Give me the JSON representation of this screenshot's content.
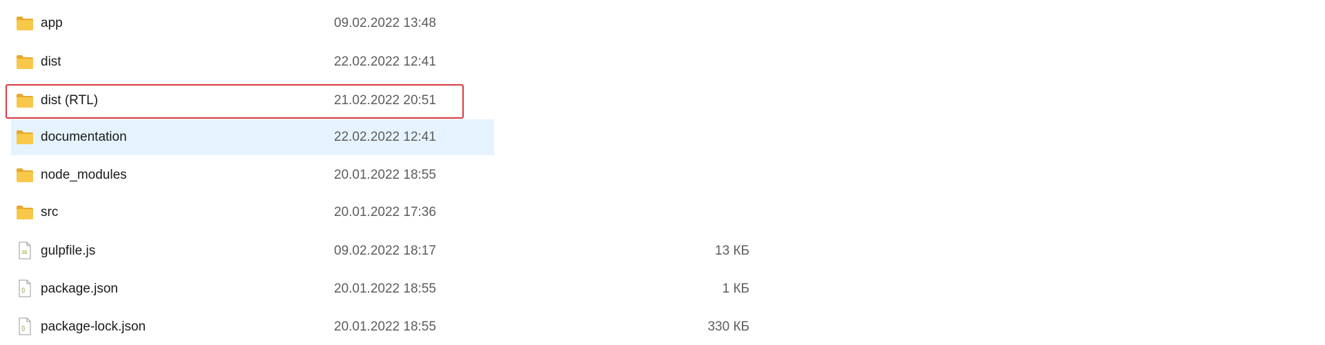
{
  "files": [
    {
      "name": "app",
      "modified": "09.02.2022 13:48",
      "size": "",
      "type": "folder-icon"
    },
    {
      "name": "dist",
      "modified": "22.02.2022 12:41",
      "size": "",
      "type": "folder-icon"
    },
    {
      "name": "dist (RTL)",
      "modified": "21.02.2022 20:51",
      "size": "",
      "type": "folder-icon"
    },
    {
      "name": "documentation",
      "modified": "22.02.2022 12:41",
      "size": "",
      "type": "folder-icon"
    },
    {
      "name": "node_modules",
      "modified": "20.01.2022 18:55",
      "size": "",
      "type": "folder-icon"
    },
    {
      "name": "src",
      "modified": "20.01.2022 17:36",
      "size": "",
      "type": "folder-icon"
    },
    {
      "name": "gulpfile.js",
      "modified": "09.02.2022 18:17",
      "size": "13 КБ",
      "type": "js-file-icon"
    },
    {
      "name": "package.json",
      "modified": "20.01.2022 18:55",
      "size": "1 КБ",
      "type": "json-file-icon"
    },
    {
      "name": "package-lock.json",
      "modified": "20.01.2022 18:55",
      "size": "330 КБ",
      "type": "json-file-icon"
    }
  ],
  "colors": {
    "folder": "#f8c84a",
    "folder_back": "#e8a92a",
    "hover_background": "#e5f3fe",
    "highlight_border": "#d9383f",
    "js_accent": "#9aba3b",
    "json_accent": "#7a9c3a"
  }
}
